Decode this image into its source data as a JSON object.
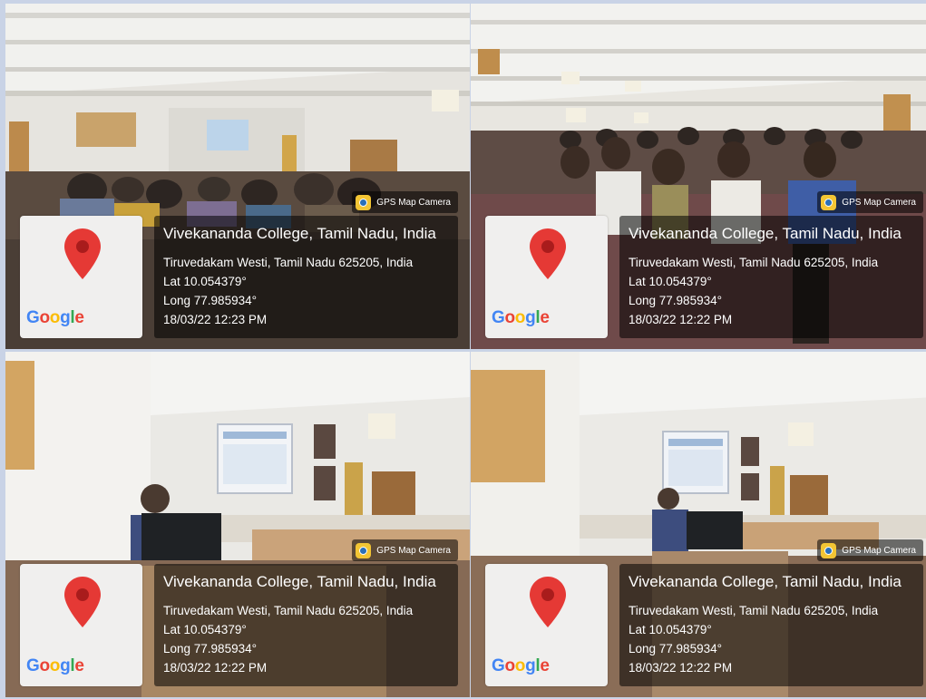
{
  "tiles": [
    {
      "badge": "GPS Map Camera",
      "place": "Vivekananda College, Tamil Nadu, India",
      "address": "Tiruvedakam Westi, Tamil Nadu 625205, India",
      "lat": "Lat 10.054379°",
      "long": "Long 77.985934°",
      "datetime": "18/03/22 12:23 PM",
      "map_logo": "Google"
    },
    {
      "badge": "GPS Map Camera",
      "place": "Vivekananda College, Tamil Nadu, India",
      "address": "Tiruvedakam Westi, Tamil Nadu 625205, India",
      "lat": "Lat 10.054379°",
      "long": "Long 77.985934°",
      "datetime": "18/03/22 12:22 PM",
      "map_logo": "Google"
    },
    {
      "badge": "GPS Map Camera",
      "place": "Vivekananda College, Tamil Nadu, India",
      "address": "Tiruvedakam Westi, Tamil Nadu 625205, India",
      "lat": "Lat 10.054379°",
      "long": "Long 77.985934°",
      "datetime": "18/03/22 12:22 PM",
      "map_logo": "Google"
    },
    {
      "badge": "GPS Map Camera",
      "place": "Vivekananda College, Tamil Nadu, India",
      "address": "Tiruvedakam Westi, Tamil Nadu 625205, India",
      "lat": "Lat 10.054379°",
      "long": "Long 77.985934°",
      "datetime": "18/03/22 12:22 PM",
      "map_logo": "Google"
    }
  ],
  "icons": {
    "badge_icon": "gps-camera-icon",
    "map_pin": "map-pin-icon"
  },
  "colors": {
    "pin_red": "#e53935",
    "google_blue": "#4285f4",
    "google_red": "#ea4335",
    "google_yellow": "#fbbc05",
    "google_green": "#34a853"
  }
}
